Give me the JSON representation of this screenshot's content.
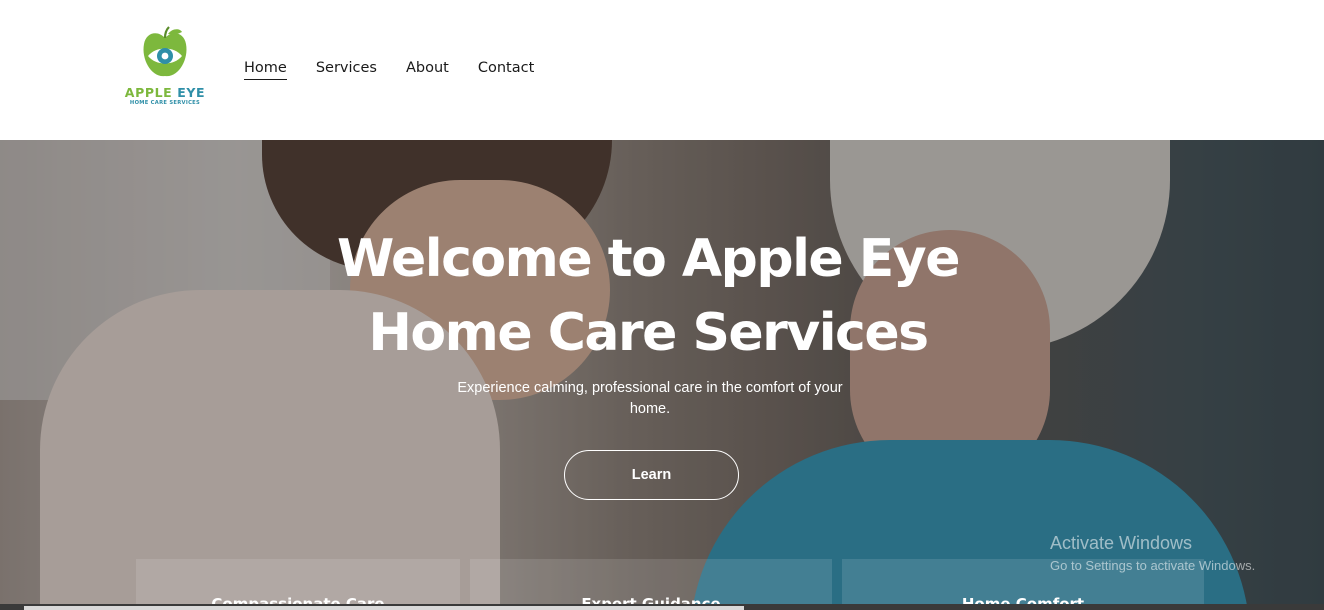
{
  "brand": {
    "name_part1": "APPLE",
    "name_part2": "EYE",
    "tagline": "HOME CARE SERVICES",
    "colors": {
      "green": "#7db83d",
      "teal": "#2f8fa8"
    }
  },
  "nav": {
    "items": [
      {
        "label": "Home",
        "active": true
      },
      {
        "label": "Services",
        "active": false
      },
      {
        "label": "About",
        "active": false
      },
      {
        "label": "Contact",
        "active": false
      }
    ]
  },
  "hero": {
    "title_line1": "Welcome to Apple Eye",
    "title_line2": "Home Care Services",
    "subtitle_line1": "Experience calming, professional care in the comfort of your",
    "subtitle_line2": "home.",
    "cta_label": "Learn"
  },
  "features": [
    {
      "label": "Compassionate Care"
    },
    {
      "label": "Expert Guidance"
    },
    {
      "label": "Home Comfort"
    }
  ],
  "watermark": {
    "line1": "Activate Windows",
    "line2": "Go to Settings to activate Windows."
  }
}
